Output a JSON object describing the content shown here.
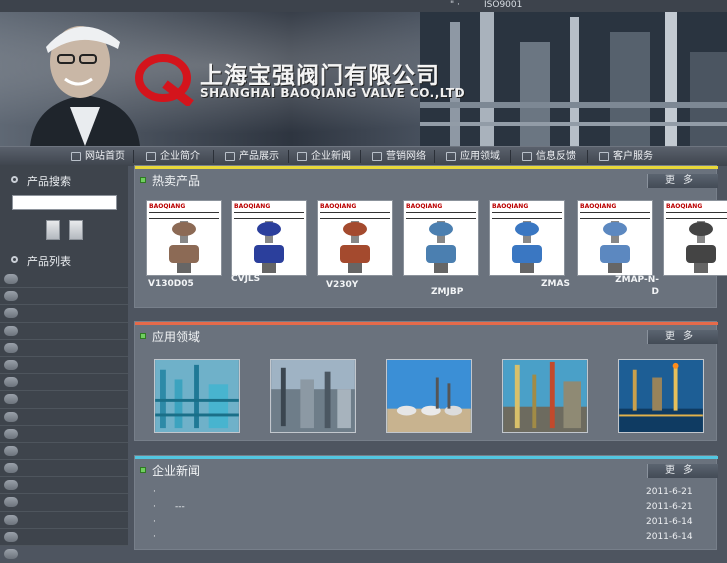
{
  "topbar": {
    "marks": "\" ·",
    "iso": "ISO9001"
  },
  "header": {
    "company_cn": "上海宝强阀门有限公司",
    "company_en": "SHANGHAI BAOQIANG VALVE CO.,LTD",
    "logo_letter": "Q"
  },
  "nav": [
    {
      "label": "网站首页",
      "icon": "home-icon"
    },
    {
      "label": "企业简介",
      "icon": "building-icon"
    },
    {
      "label": "产品展示",
      "icon": "box-icon"
    },
    {
      "label": "企业新闻",
      "icon": "globe-icon"
    },
    {
      "label": "营销网络",
      "icon": "network-icon"
    },
    {
      "label": "应用领域",
      "icon": "document-icon"
    },
    {
      "label": "信息反馈",
      "icon": "feedback-icon"
    },
    {
      "label": "客户服务",
      "icon": "service-icon"
    }
  ],
  "sidebar": {
    "search_title": "产品搜索",
    "list_title": "产品列表"
  },
  "hot": {
    "title": "热卖产品",
    "more": "更多",
    "products": [
      {
        "label": "V130D05",
        "brand": "BAOQIANG"
      },
      {
        "label": "CVJLS",
        "brand": "BAOQIANG"
      },
      {
        "label": "V230Y",
        "brand": "BAOQIANG"
      },
      {
        "label": "ZMJBP",
        "brand": "BAOQIANG"
      },
      {
        "label": "ZMAS",
        "brand": "BAOQIANG"
      },
      {
        "label": "ZMAP-N-D",
        "brand": "BAOQIANG"
      },
      {
        "label": "",
        "brand": "BAOQIANG"
      }
    ]
  },
  "apps": {
    "title": "应用领域",
    "more": "更多"
  },
  "news": {
    "title": "企业新闻",
    "more": "更多",
    "items": [
      {
        "bullet": "·",
        "text": "",
        "date": "2011-6-21"
      },
      {
        "bullet": "·",
        "text": "---",
        "date": "2011-6-21"
      },
      {
        "bullet": "·",
        "text": "",
        "date": "2011-6-14"
      },
      {
        "bullet": "·",
        "text": "",
        "date": "2011-6-14"
      }
    ]
  },
  "colors": {
    "hot_line": "#e8d83a",
    "apps_line": "#e56a4a",
    "news_line": "#53c6e0"
  }
}
